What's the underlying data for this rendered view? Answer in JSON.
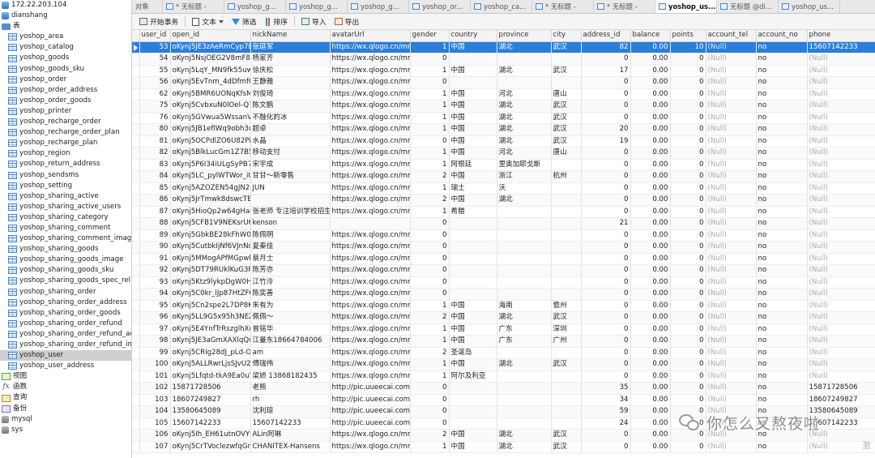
{
  "navigator": {
    "items": [
      {
        "label": "172.22.203.104",
        "type": "server"
      },
      {
        "label": "dianshang",
        "type": "db"
      },
      {
        "label": "表",
        "type": "folder"
      },
      {
        "label": "yoshop_area",
        "type": "table"
      },
      {
        "label": "yoshop_catalog",
        "type": "table"
      },
      {
        "label": "yoshop_goods",
        "type": "table"
      },
      {
        "label": "yoshop_goods_sku",
        "type": "table"
      },
      {
        "label": "yoshop_order",
        "type": "table"
      },
      {
        "label": "yoshop_order_address",
        "type": "table"
      },
      {
        "label": "yoshop_order_goods",
        "type": "table"
      },
      {
        "label": "yoshop_printer",
        "type": "table"
      },
      {
        "label": "yoshop_recharge_order",
        "type": "table"
      },
      {
        "label": "yoshop_recharge_order_plan",
        "type": "table"
      },
      {
        "label": "yoshop_recharge_plan",
        "type": "table"
      },
      {
        "label": "yoshop_region",
        "type": "table"
      },
      {
        "label": "yoshop_return_address",
        "type": "table"
      },
      {
        "label": "yoshop_sendsms",
        "type": "table"
      },
      {
        "label": "yoshop_setting",
        "type": "table"
      },
      {
        "label": "yoshop_sharing_active",
        "type": "table"
      },
      {
        "label": "yoshop_sharing_active_users",
        "type": "table"
      },
      {
        "label": "yoshop_sharing_category",
        "type": "table"
      },
      {
        "label": "yoshop_sharing_comment",
        "type": "table"
      },
      {
        "label": "yoshop_sharing_comment_image",
        "type": "table"
      },
      {
        "label": "yoshop_sharing_goods",
        "type": "table"
      },
      {
        "label": "yoshop_sharing_goods_image",
        "type": "table"
      },
      {
        "label": "yoshop_sharing_goods_sku",
        "type": "table"
      },
      {
        "label": "yoshop_sharing_goods_spec_rel",
        "type": "table"
      },
      {
        "label": "yoshop_sharing_order",
        "type": "table"
      },
      {
        "label": "yoshop_sharing_order_address",
        "type": "table"
      },
      {
        "label": "yoshop_sharing_order_goods",
        "type": "table"
      },
      {
        "label": "yoshop_sharing_order_refund",
        "type": "table"
      },
      {
        "label": "yoshop_sharing_order_refund_address",
        "type": "table"
      },
      {
        "label": "yoshop_sharing_order_refund_image",
        "type": "table"
      },
      {
        "label": "yoshop_user",
        "type": "table",
        "selected": true
      },
      {
        "label": "yoshop_user_address",
        "type": "table"
      },
      {
        "label": "视图",
        "type": "view"
      },
      {
        "label": "函数",
        "type": "func"
      },
      {
        "label": "查询",
        "type": "query"
      },
      {
        "label": "备份",
        "type": "backup"
      },
      {
        "label": "mysql",
        "type": "db2"
      },
      {
        "label": "sys",
        "type": "db2"
      }
    ]
  },
  "tabs": [
    {
      "label": "对象",
      "kind": "obj"
    },
    {
      "label": "* 无标题 -",
      "kind": "query"
    },
    {
      "label": "yoshop_g...",
      "kind": "table"
    },
    {
      "label": "yoshop_g...",
      "kind": "table"
    },
    {
      "label": "yoshop_g...",
      "kind": "table"
    },
    {
      "label": "yoshop_or...",
      "kind": "table"
    },
    {
      "label": "yoshop_ca...",
      "kind": "table"
    },
    {
      "label": "* 无标题 -",
      "kind": "query"
    },
    {
      "label": "* 无标题 -",
      "kind": "query"
    },
    {
      "label": "yoshop_us...",
      "kind": "table",
      "active": true
    },
    {
      "label": "无标题 @di...",
      "kind": "query"
    },
    {
      "label": "yoshop_us...",
      "kind": "table"
    }
  ],
  "toolbar": {
    "begin_label": "开始事务",
    "text_label": "文本",
    "filter_label": "筛选",
    "sort_label": "排序",
    "import_label": "导入",
    "export_label": "导出"
  },
  "grid": {
    "columns": [
      "user_id",
      "open_id",
      "nickName",
      "avatarUrl",
      "gender",
      "country",
      "province",
      "city",
      "address_id",
      "balance",
      "points",
      "account_tel",
      "account_no",
      "phone"
    ],
    "rows": [
      [
        "53",
        "oKynj5JE3zAeRmCyp7EqO",
        "张珽军",
        "https://wx.qlogo.cn/mmo",
        "1",
        "中国",
        "湖北",
        "武汉",
        "82",
        "0.00",
        "10",
        "(Null)",
        "no",
        "15607142233"
      ],
      [
        "54",
        "oKynj5NsjOEG2V8mF8hO",
        "杨家齐",
        "https://wx.qlogo.cn/mmh",
        "0",
        "",
        "",
        "",
        "0",
        "0.00",
        "0",
        "(Null)",
        "no",
        "(Null)"
      ],
      [
        "55",
        "oKynj5LqY_MN9fk55uwH",
        "徐庆松",
        "https://wx.qlogo.cn/mmh",
        "1",
        "中国",
        "湖北",
        "武汉",
        "17",
        "0.00",
        "0",
        "(Null)",
        "no",
        "(Null)"
      ],
      [
        "56",
        "oKynj5EvTnm_4dDfmfOU",
        "王静雅",
        "https://wx.qlogo.cn/mmh",
        "0",
        "",
        "",
        "",
        "0",
        "0.00",
        "0",
        "(Null)",
        "no",
        "(Null)"
      ],
      [
        "62",
        "oKynj5BMR6UONqKfsMY",
        "刘俊琦",
        "https://wx.qlogo.cn/mmo",
        "1",
        "中国",
        "河北",
        "唐山",
        "0",
        "0.00",
        "0",
        "(Null)",
        "no",
        "(Null)"
      ],
      [
        "75",
        "oKynj5CvbxuN0lOel-Q7M",
        "陈文鹏",
        "https://wx.qlogo.cn/mmo",
        "1",
        "中国",
        "湖北",
        "武汉",
        "0",
        "0.00",
        "0",
        "(Null)",
        "no",
        "(Null)"
      ],
      [
        "76",
        "oKynj5GVwua5WssanVUC",
        "不融化的冰",
        "https://wx.qlogo.cn/mmo",
        "1",
        "中国",
        "湖北",
        "武汉",
        "0",
        "0.00",
        "0",
        "(Null)",
        "no",
        "(Null)"
      ],
      [
        "80",
        "oKynj5JB1efIWq9obh3u1",
        "超卓",
        "https://wx.qlogo.cn/mmo",
        "1",
        "中国",
        "湖北",
        "武汉",
        "20",
        "0.00",
        "0",
        "(Null)",
        "no",
        "(Null)"
      ],
      [
        "81",
        "oKynj5OCPdlZO6U82Pigz",
        "水晶",
        "https://wx.qlogo.cn/mmo",
        "0",
        "中国",
        "湖北",
        "武汉",
        "19",
        "0.00",
        "0",
        "(Null)",
        "no",
        "(Null)"
      ],
      [
        "82",
        "oKynj5BlkLucGm1Z7B5zr",
        "移动支付",
        "https://wx.qlogo.cn/mmo",
        "1",
        "中国",
        "河北",
        "唐山",
        "0",
        "0.00",
        "0",
        "(Null)",
        "no",
        "(Null)"
      ],
      [
        "83",
        "oKynj5P6I34iULgSyPB7Ce",
        "宋宇成",
        "https://wx.qlogo.cn/mmo",
        "1",
        "阿根廷",
        "里奥加耶戈斯",
        "",
        "0",
        "0.00",
        "0",
        "(Null)",
        "no",
        "(Null)"
      ],
      [
        "84",
        "oKynj5LC_pylWTWor_iUC",
        "甘甘～新零售",
        "https://wx.qlogo.cn/mmo",
        "2",
        "中国",
        "浙江",
        "杭州",
        "0",
        "0.00",
        "0",
        "(Null)",
        "no",
        "(Null)"
      ],
      [
        "85",
        "oKynj5AZOZEN54gJN2-8e",
        "JUN",
        "https://wx.qlogo.cn/mmo",
        "1",
        "瑞士",
        "沃",
        "",
        "0",
        "0.00",
        "0",
        "(Null)",
        "no",
        "(Null)"
      ],
      [
        "86",
        "oKynj5JrTmwk8dswcTBC-",
        "",
        "https://wx.qlogo.cn/mmo",
        "2",
        "中国",
        "湖北",
        "",
        "0",
        "0.00",
        "0",
        "(Null)",
        "no",
        "(Null)"
      ],
      [
        "87",
        "oKynj5HioQp2w64gHacG",
        "张老师 专注培训学校招生发",
        "https://wx.qlogo.cn/mmo",
        "1",
        "希腊",
        "",
        "",
        "0",
        "0.00",
        "0",
        "(Null)",
        "no",
        "(Null)"
      ],
      [
        "88",
        "oKynj5CFB1V9NEKsrU6VE",
        "kenson",
        "",
        "0",
        "",
        "",
        "",
        "21",
        "0.00",
        "0",
        "(Null)",
        "no",
        "(Null)"
      ],
      [
        "89",
        "oKynj5GbkBE28kFhW0akI",
        "陈佩明",
        "https://wx.qlogo.cn/mmh",
        "0",
        "",
        "",
        "",
        "0",
        "0.00",
        "0",
        "(Null)",
        "no",
        "(Null)"
      ],
      [
        "90",
        "oKynj5CutbkIjNf6VJnNdV",
        "夏秦佳",
        "https://wx.qlogo.cn/mmo",
        "0",
        "",
        "",
        "",
        "0",
        "0.00",
        "0",
        "(Null)",
        "no",
        "(Null)"
      ],
      [
        "91",
        "oKynj5MMogAPfMGpwhH",
        "蔡月士",
        "https://wx.qlogo.cn/mmo",
        "0",
        "",
        "",
        "",
        "0",
        "0.00",
        "0",
        "(Null)",
        "no",
        "(Null)"
      ],
      [
        "92",
        "oKynj5DT79RUklKuG3P7v",
        "陈芳亦",
        "https://wx.qlogo.cn/mmo",
        "0",
        "",
        "",
        "",
        "0",
        "0.00",
        "0",
        "(Null)",
        "no",
        "(Null)"
      ],
      [
        "93",
        "oKynj5Ktz9lykpDgW0Hsm",
        "江竹泠",
        "https://wx.qlogo.cn/mmo",
        "0",
        "",
        "",
        "",
        "0",
        "0.00",
        "0",
        "(Null)",
        "no",
        "(Null)"
      ],
      [
        "94",
        "oKynj5C0kr_lJp87HtZFGN",
        "陈奕善",
        "https://wx.qlogo.cn/mmo",
        "0",
        "",
        "",
        "",
        "0",
        "0.00",
        "0",
        "(Null)",
        "no",
        "(Null)"
      ],
      [
        "95",
        "oKynj5Cn2spe2L7DP8Kq2",
        "朱有为",
        "https://wx.qlogo.cn/mmo",
        "1",
        "中国",
        "海南",
        "儋州",
        "0",
        "0.00",
        "0",
        "(Null)",
        "no",
        "(Null)"
      ],
      [
        "96",
        "oKynj5LL9G5x95h3NEZDx",
        "佩佩～",
        "https://wx.qlogo.cn/mmo",
        "2",
        "中国",
        "湖北",
        "武汉",
        "0",
        "0.00",
        "0",
        "(Null)",
        "no",
        "(Null)"
      ],
      [
        "97",
        "oKynj5E4YnfTrRszglhXoX",
        "曾铭华",
        "https://wx.qlogo.cn/mmo",
        "1",
        "中国",
        "广东",
        "深圳",
        "0",
        "0.00",
        "0",
        "(Null)",
        "no",
        "(Null)"
      ],
      [
        "98",
        "oKynj5JE3aGmXAXlqQwa",
        "江曼东18664784006",
        "https://wx.qlogo.cn/mmo",
        "1",
        "中国",
        "广东",
        "广州",
        "0",
        "0.00",
        "0",
        "(Null)",
        "no",
        "(Null)"
      ],
      [
        "99",
        "oKynj5CRIg28dJ_pLd-OLt",
        "am",
        "https://wx.qlogo.cn/mmo",
        "2",
        "圣诞岛",
        "",
        "",
        "0",
        "0.00",
        "0",
        "(Null)",
        "no",
        "(Null)"
      ],
      [
        "100",
        "oKynj5ALLRwrLjsSJvU2CK",
        "傅瑞伟",
        "https://wx.qlogo.cn/mmo",
        "1",
        "中国",
        "湖北",
        "武汉",
        "0",
        "0.00",
        "0",
        "(Null)",
        "no",
        "(Null)"
      ],
      [
        "101",
        "oKynj5Lfqtd-tkA9Ea0uYSD",
        "梁娇 13868182435",
        "https://wx.qlogo.cn/mmo",
        "1",
        "阿尔及利亚",
        "",
        "",
        "0",
        "0.00",
        "0",
        "(Null)",
        "no",
        "(Null)"
      ],
      [
        "102",
        "15871728506",
        "老熊",
        "http://pic.uueecai.com/uplc",
        "0",
        "",
        "",
        "",
        "35",
        "0.00",
        "0",
        "(Null)",
        "no",
        "15871728506"
      ],
      [
        "103",
        "18607249827",
        "rh",
        "http://pic.uueecai.com/uplc",
        "0",
        "",
        "",
        "",
        "34",
        "0.00",
        "0",
        "(Null)",
        "no",
        "18607249827"
      ],
      [
        "104",
        "13580645089",
        "沈利琼",
        "http://pic.uueecai.com/uplc",
        "0",
        "",
        "",
        "",
        "59",
        "0.00",
        "0",
        "(Null)",
        "no",
        "13580645089"
      ],
      [
        "105",
        "15607142233",
        "15607142233",
        "http://pic.uueecai.com/uplc",
        "0",
        "",
        "",
        "",
        "24",
        "0.00",
        "0",
        "(Null)",
        "no",
        "15607142233"
      ],
      [
        "106",
        "oKynj5Ih_EH61utnOVYQ0I",
        "ALin阿琳",
        "https://wx.qlogo.cn/mmo",
        "2",
        "中国",
        "湖北",
        "武汉",
        "0",
        "0.00",
        "0",
        "(Null)",
        "no",
        "(Null)"
      ],
      [
        "107",
        "oKynj5CrTVoclezwfqGrsH",
        "CHANITEX-Hansens",
        "https://wx.qlogo.cn/mmo",
        "1",
        "中国",
        "湖北",
        "武汉",
        "0",
        "0.00",
        "0",
        "(Null)",
        "no",
        "(Null)"
      ]
    ],
    "selected_row": 0
  },
  "watermark": {
    "text": "你怎么又熬夜啦",
    "corner": "激"
  }
}
